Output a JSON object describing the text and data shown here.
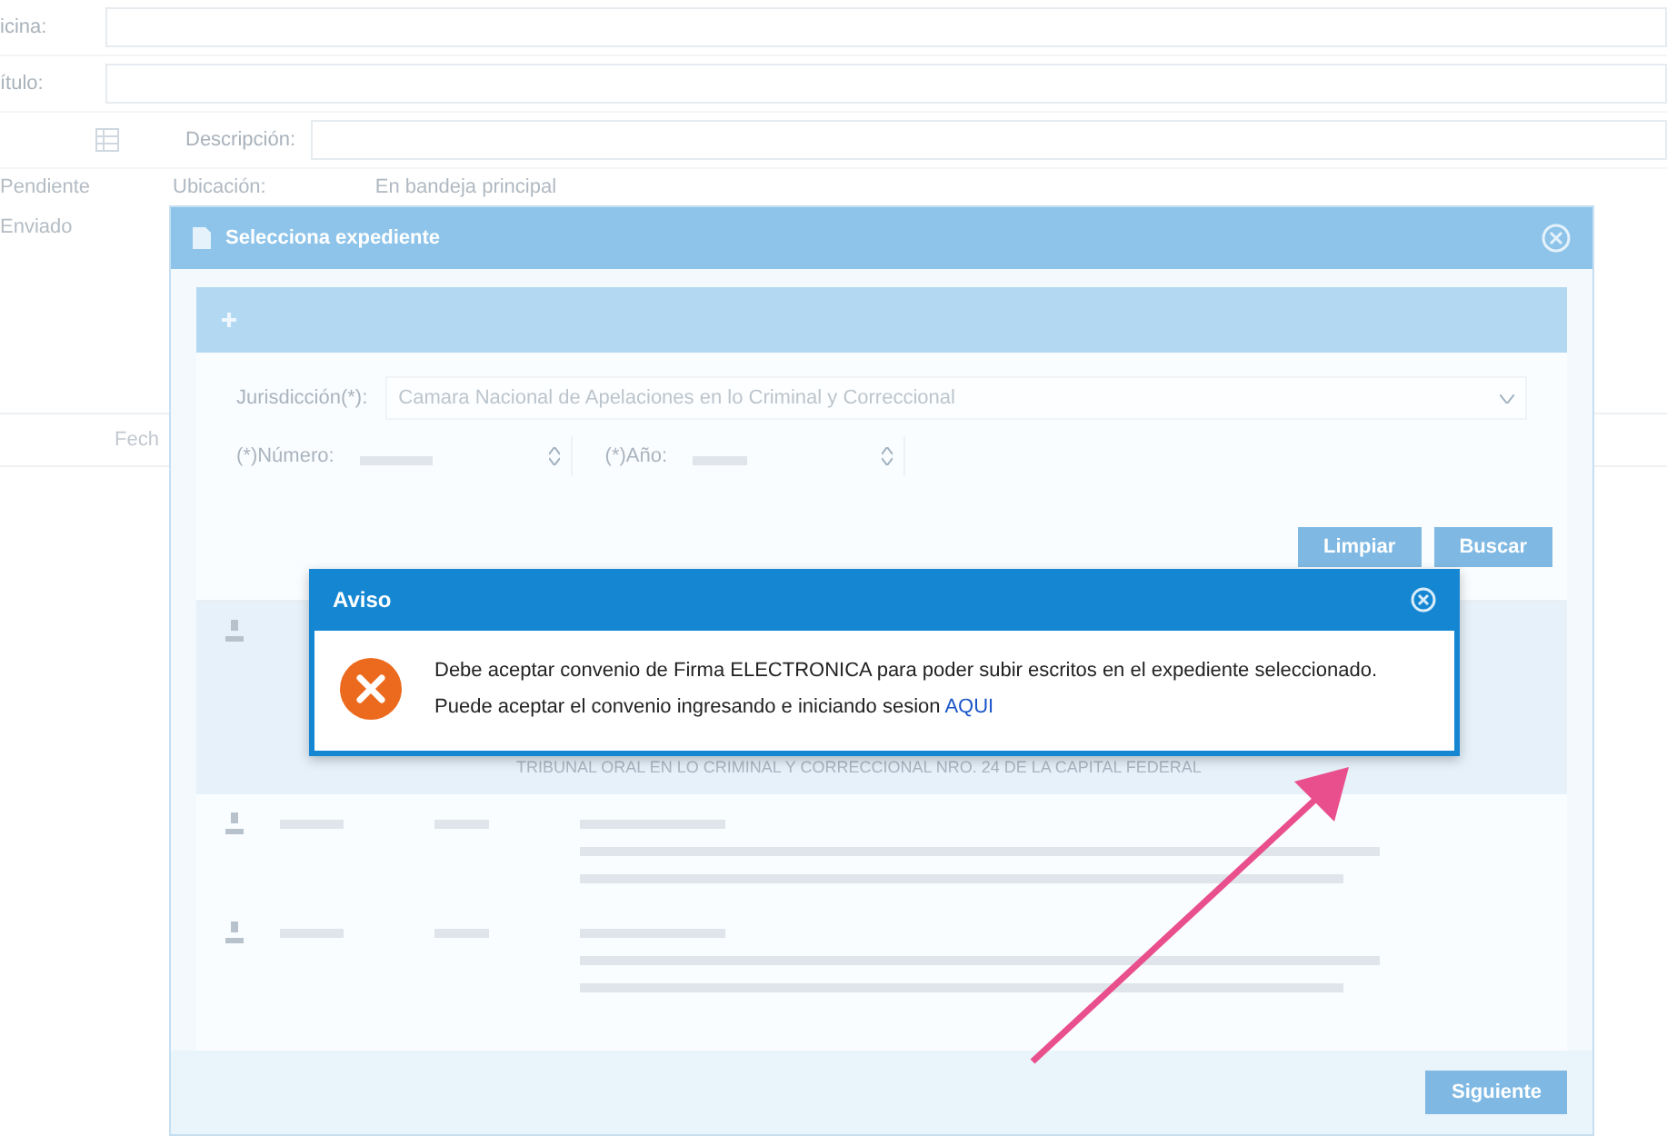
{
  "page": {
    "fields": [
      {
        "label": "icina:"
      },
      {
        "label": "ítulo:"
      }
    ],
    "description_label": "Descripción:",
    "status_items": [
      "Pendiente",
      "Enviado"
    ],
    "location_label": "Ubicación:",
    "location_value": "En bandeja principal",
    "column_cut": "Fech"
  },
  "modal": {
    "title": "Selecciona expediente",
    "jurisdiction_label": "Jurisdicción(*):",
    "jurisdiction_value": "Camara Nacional de Apelaciones en lo Criminal y Correccional",
    "number_label": "(*)Número:",
    "year_label": "(*)Año:",
    "buttons": [
      "Limpiar",
      "Buscar"
    ],
    "rows": [
      {
        "selected": true,
        "text": "TRIBUNAL ORAL EN LO CRIMINAL Y CORRECCIONAL NRO. 24 DE LA CAPITAL FEDERAL"
      },
      {
        "selected": false
      },
      {
        "selected": false
      }
    ],
    "footer_button": "Siguiente"
  },
  "alert": {
    "title": "Aviso",
    "message": "Debe aceptar convenio de Firma ELECTRONICA para poder subir escritos en el expediente seleccionado. Puede aceptar el convenio ingresando e iniciando sesion",
    "link": "AQUI"
  }
}
